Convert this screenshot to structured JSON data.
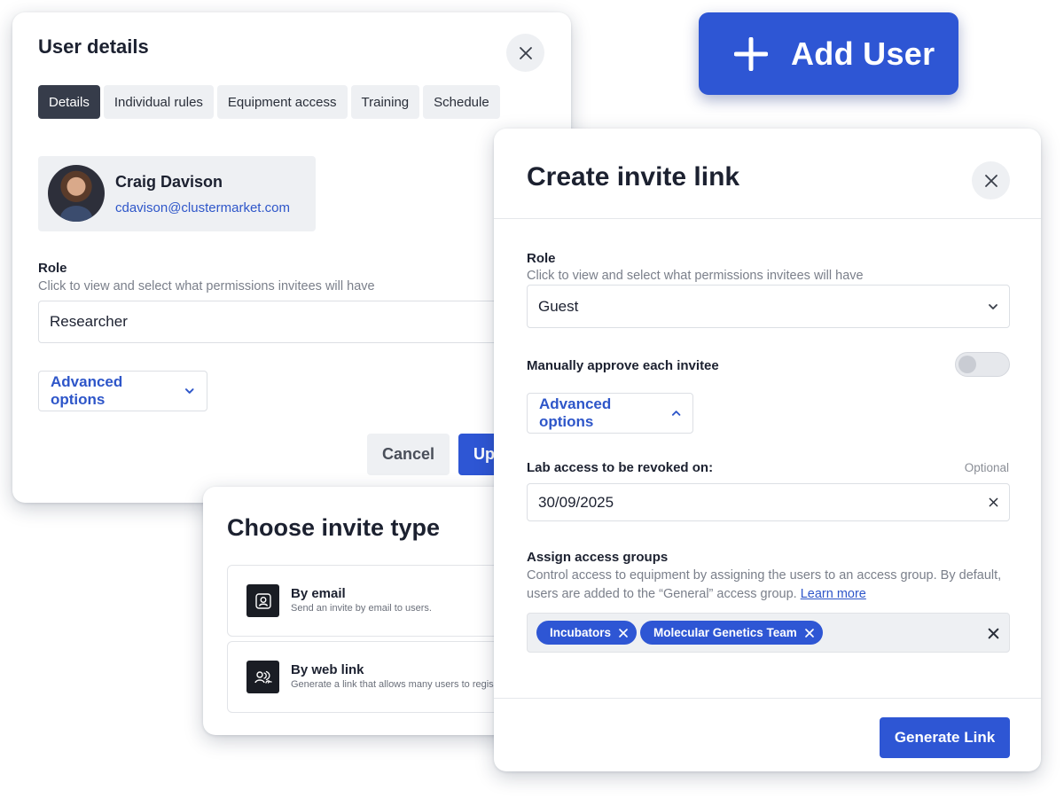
{
  "user_details": {
    "title": "User details",
    "tabs": [
      {
        "label": "Details",
        "active": true
      },
      {
        "label": "Individual rules",
        "active": false
      },
      {
        "label": "Equipment access",
        "active": false
      },
      {
        "label": "Training",
        "active": false
      },
      {
        "label": "Schedule",
        "active": false
      }
    ],
    "user": {
      "name": "Craig Davison",
      "email": "cdavison@clustermarket.com"
    },
    "role_label": "Role",
    "role_help": "Click to view and select what permissions invitees will have",
    "role_value": "Researcher",
    "advanced_label": "Advanced options",
    "cancel_label": "Cancel",
    "update_label": "Up"
  },
  "add_user_button": {
    "label": "Add User",
    "icon": "plus-icon"
  },
  "invite_type": {
    "title": "Choose invite type",
    "options": [
      {
        "title": "By email",
        "description": "Send an invite by email to users.",
        "icon": "user-icon"
      },
      {
        "title": "By web link",
        "description": "Generate a link that allows many users to regis",
        "icon": "users-link-icon"
      }
    ]
  },
  "invite_link": {
    "title": "Create invite link",
    "role_label": "Role",
    "role_help": "Click to view and select what permissions invitees will have",
    "role_value": "Guest",
    "approve_label": "Manually approve each invitee",
    "approve_enabled": false,
    "advanced_label": "Advanced options",
    "revoke_label": "Lab access to be revoked on:",
    "optional_label": "Optional",
    "revoke_date": "30/09/2025",
    "groups_label": "Assign access groups",
    "groups_help": "Control access to equipment by assigning the users to an access group. By default, users are added to the “General” access group.",
    "learn_more": "Learn more",
    "groups": [
      "Incubators",
      "Molecular Genetics Team"
    ],
    "generate_label": "Generate Link"
  },
  "colors": {
    "accent": "#2e56d4",
    "link": "#2e56c9",
    "tab_active": "#363c4a",
    "muted_bg": "#eef0f3"
  }
}
